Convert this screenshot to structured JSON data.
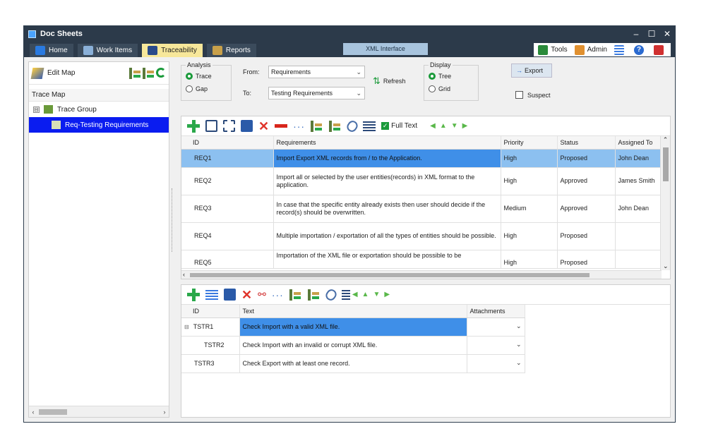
{
  "window": {
    "title": "Doc Sheets",
    "controls": [
      "–",
      "☐",
      "✕"
    ]
  },
  "tabs": [
    {
      "label": "Home",
      "icon": "home-icon",
      "color": "#2a7ae0"
    },
    {
      "label": "Work Items",
      "icon": "work-items-icon",
      "color": "#8ab0d8"
    },
    {
      "label": "Traceability",
      "icon": "traceability-icon",
      "color": "#2a4a8a",
      "active": true
    },
    {
      "label": "Reports",
      "icon": "reports-icon",
      "color": "#c8a04a"
    }
  ],
  "xml_tab": "XML Interface",
  "right_tools": {
    "tools": "Tools",
    "admin": "Admin"
  },
  "left_panel": {
    "edit_map": "Edit Map",
    "trace_map": "Trace Map",
    "tree": [
      {
        "label": "Trace Group",
        "expander": "⊟"
      },
      {
        "label": "Req-Testing Requirements"
      }
    ]
  },
  "analysis": {
    "legend": "Analysis",
    "options": [
      "Trace",
      "Gap"
    ],
    "selected": "Trace"
  },
  "from": {
    "label": "From:",
    "value": "Requirements"
  },
  "to": {
    "label": "To:",
    "value": "Testing Requirements"
  },
  "refresh": "Refresh",
  "display": {
    "legend": "Display",
    "options": [
      "Tree",
      "Grid"
    ],
    "selected": "Tree"
  },
  "export": "Export",
  "suspect": "Suspect",
  "top_toolbar": {
    "full_text": "Full Text"
  },
  "requirements_grid": {
    "columns": [
      "ID",
      "Requirements",
      "Priority",
      "Status",
      "Assigned To"
    ],
    "rows": [
      {
        "id": "REQ1",
        "text": "Import Export XML records from / to the Application.",
        "priority": "High",
        "status": "Proposed",
        "assigned": "John Dean"
      },
      {
        "id": "REQ2",
        "text": "Import all or selected by the user entities(records) in XML format  to the application.",
        "priority": "High",
        "status": "Approved",
        "assigned": "James Smith"
      },
      {
        "id": "REQ3",
        "text": "In case that the specific entity already exists then user should decide if the record(s) should be overwritten.",
        "priority": "Medium",
        "status": "Approved",
        "assigned": "John Dean"
      },
      {
        "id": "REQ4",
        "text": "Multiple importation / exportation of all the types of entities should be possible.",
        "priority": "High",
        "status": "Proposed",
        "assigned": ""
      },
      {
        "id": "REQ5",
        "text": "Importation of the XML file or exportation should be possible to be",
        "priority": "High",
        "status": "Proposed",
        "assigned": ""
      }
    ]
  },
  "test_grid": {
    "columns": [
      "ID",
      "Text",
      "Attachments"
    ],
    "rows": [
      {
        "id": "TSTR1",
        "text": "Check Import with a valid XML file.",
        "expander": "⊟"
      },
      {
        "id": "TSTR2",
        "text": "Check Import with an invalid or corrupt XML file.",
        "expander": ""
      },
      {
        "id": "TSTR3",
        "text": "Check Export with at least one record.",
        "expander": ""
      }
    ]
  }
}
